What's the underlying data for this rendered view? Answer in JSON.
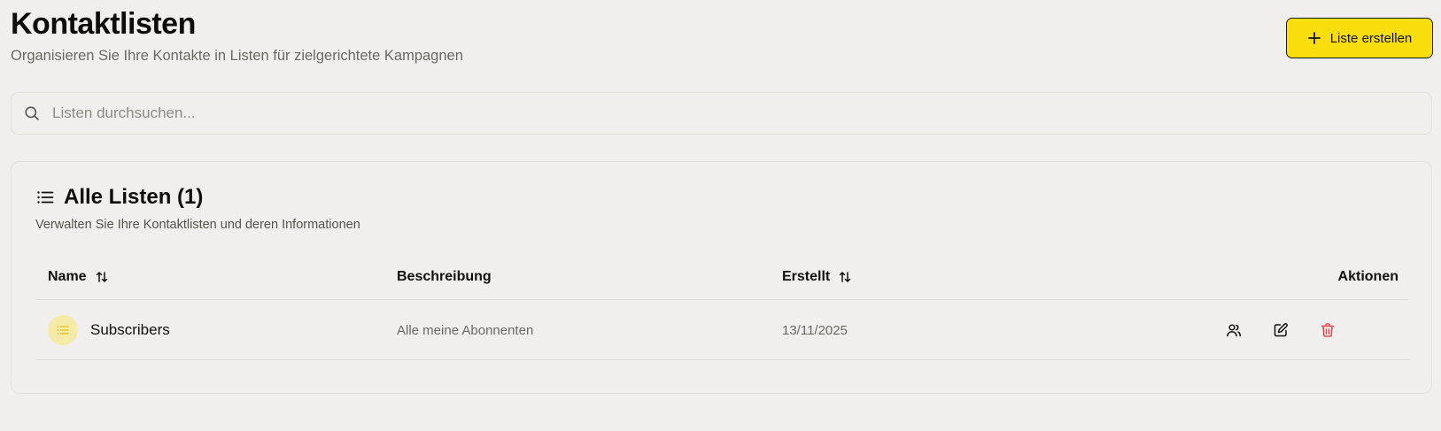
{
  "header": {
    "title": "Kontaktlisten",
    "subtitle": "Organisieren Sie Ihre Kontakte in Listen für zielgerichtete Kampagnen",
    "create_button_label": "Liste erstellen"
  },
  "search": {
    "placeholder": "Listen durchsuchen...",
    "value": ""
  },
  "lists_card": {
    "title": "Alle Listen (1)",
    "description": "Verwalten Sie Ihre Kontaktlisten und deren Informationen",
    "columns": {
      "name": "Name",
      "description": "Beschreibung",
      "created": "Erstellt",
      "actions": "Aktionen"
    },
    "rows": [
      {
        "name": "Subscribers",
        "description": "Alle meine Abonnenten",
        "created": "13/11/2025"
      }
    ]
  },
  "icons": {
    "create": "plus-icon",
    "search": "search-icon",
    "card_header": "list-icon",
    "sort": "sort-arrows-icon",
    "row_avatar": "list-icon",
    "row_actions": [
      "users-icon",
      "edit-icon",
      "trash-icon"
    ]
  },
  "colors": {
    "accent": "#fadd0c",
    "background": "#f1efed",
    "danger": "#e5484d",
    "avatar_bg": "#f6eaa8"
  }
}
